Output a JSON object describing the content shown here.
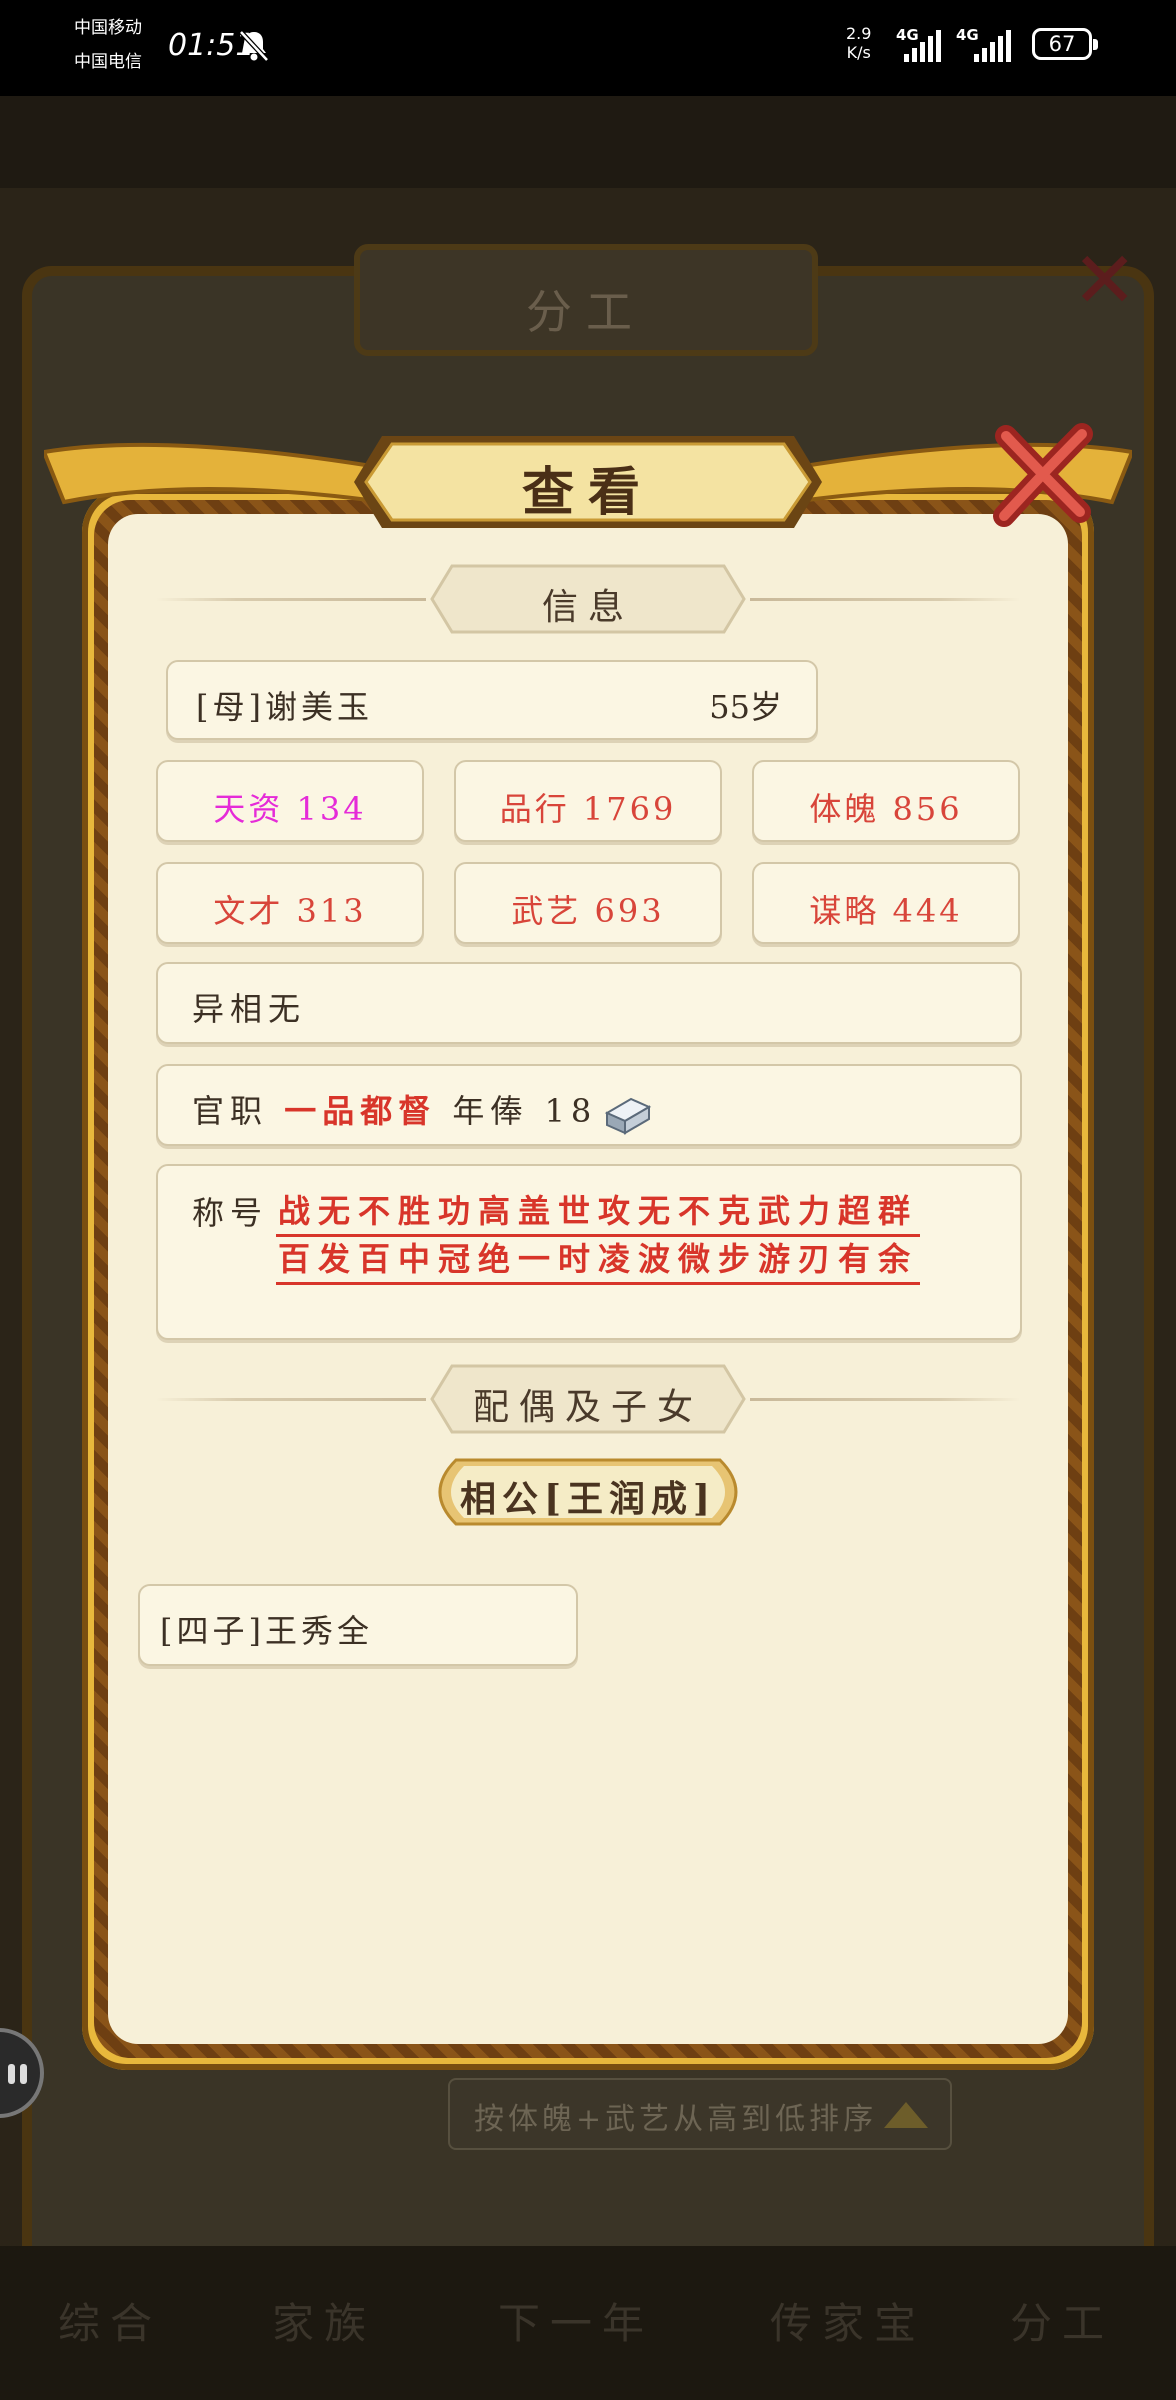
{
  "status_bar": {
    "carrier_1": "中国移动",
    "carrier_2": "中国电信",
    "time": "01:51",
    "net_speed_value": "2.9",
    "net_speed_unit": "K/s",
    "signal_1_label": "4G",
    "signal_2_label": "4G",
    "battery": "67"
  },
  "background": {
    "panel_title": "分工",
    "sort_button_label": "按体魄+武艺从高到低排序",
    "bottom_nav": [
      "综合",
      "家族",
      "下一年",
      "传家宝",
      "分工"
    ]
  },
  "dialog": {
    "title": "查看",
    "info_section": "信息",
    "person": {
      "name": "[母]谢美玉",
      "age": "55岁"
    },
    "stats": [
      {
        "text": "天资 134",
        "color": "#e52bd8"
      },
      {
        "text": "品行 1769",
        "color": "#d8453a"
      },
      {
        "text": "体魄 856",
        "color": "#d8453a"
      },
      {
        "text": "文才 313",
        "color": "#d8453a"
      },
      {
        "text": "武艺 693",
        "color": "#d8453a"
      },
      {
        "text": "谋略 444",
        "color": "#d8453a"
      }
    ],
    "trait": "异相无",
    "office": {
      "label": "官职",
      "rank": "一品都督",
      "salary_label": "年俸",
      "salary_value": "18",
      "currency_icon": "silver-ingot-icon"
    },
    "honors": {
      "label": "称号",
      "line1": "战无不胜功高盖世攻无不克武力超群",
      "line2": "百发百中冠绝一时凌波微步游刃有余"
    },
    "family_section": "配偶及子女",
    "spouse": "相公[王润成]",
    "children": [
      "[四子]王秀全"
    ]
  }
}
